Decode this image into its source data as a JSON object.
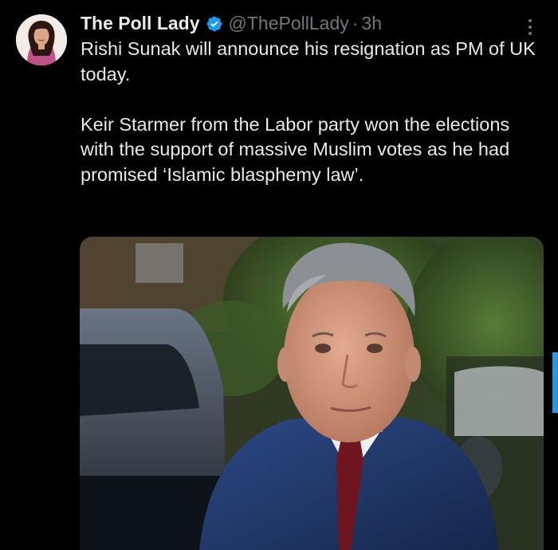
{
  "author": {
    "display_name": "The Poll Lady",
    "handle": "@ThePollLady",
    "separator": "·",
    "time": "3h",
    "verified": true,
    "verified_color": "#1d9bf0"
  },
  "tweet": {
    "paragraphs": [
      "Rishi Sunak will announce his resignation as PM of UK today.",
      "Keir Starmer from the Labor party won the elections with the support of massive Muslim votes as he had promised ‘Islamic blasphemy law’."
    ]
  },
  "icons": {
    "verified": "verified-badge-icon",
    "more": "more-options-icon"
  },
  "colors": {
    "background": "#000000",
    "text": "#e7e9ea",
    "secondary_text": "#71767b",
    "accent": "#1d9bf0"
  }
}
